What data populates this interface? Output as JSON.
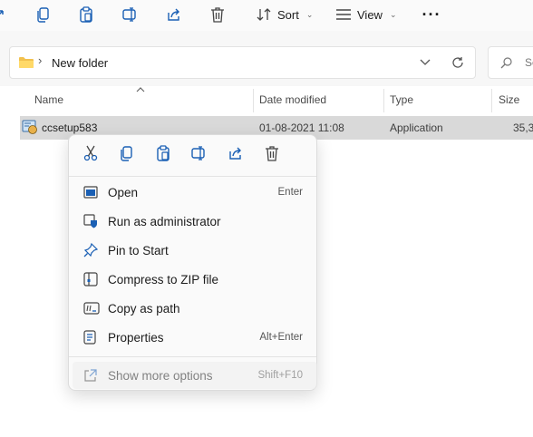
{
  "toolbar": {
    "sort_label": "Sort",
    "view_label": "View",
    "icons": [
      "partial-share-icon",
      "copy-icon",
      "paste-icon",
      "rename-icon",
      "share-icon",
      "delete-icon",
      "sort-icon",
      "view-icon",
      "more-icon"
    ]
  },
  "address": {
    "path": "New folder",
    "search_placeholder": "Se"
  },
  "columns": {
    "name": "Name",
    "date": "Date modified",
    "type": "Type",
    "size": "Size"
  },
  "file": {
    "name": "ccsetup583",
    "date": "01-08-2021 11:08",
    "type": "Application",
    "size": "35,3"
  },
  "menu": {
    "quick_actions": [
      "cut-icon",
      "copy-icon",
      "paste-icon",
      "rename-icon",
      "share-icon",
      "delete-icon"
    ],
    "items": [
      {
        "label": "Open",
        "shortcut": "Enter",
        "icon": "open-icon"
      },
      {
        "label": "Run as administrator",
        "shortcut": "",
        "icon": "shield-icon"
      },
      {
        "label": "Pin to Start",
        "shortcut": "",
        "icon": "pin-icon"
      },
      {
        "label": "Compress to ZIP file",
        "shortcut": "",
        "icon": "zip-icon"
      },
      {
        "label": "Copy as path",
        "shortcut": "",
        "icon": "path-icon"
      },
      {
        "label": "Properties",
        "shortcut": "Alt+Enter",
        "icon": "properties-icon"
      }
    ],
    "more": {
      "label": "Show more options",
      "shortcut": "Shift+F10",
      "icon": "external-icon"
    }
  },
  "colors": {
    "accent": "#0067c0",
    "folder": "#f2c14e",
    "selection": "#d9d9d9"
  }
}
